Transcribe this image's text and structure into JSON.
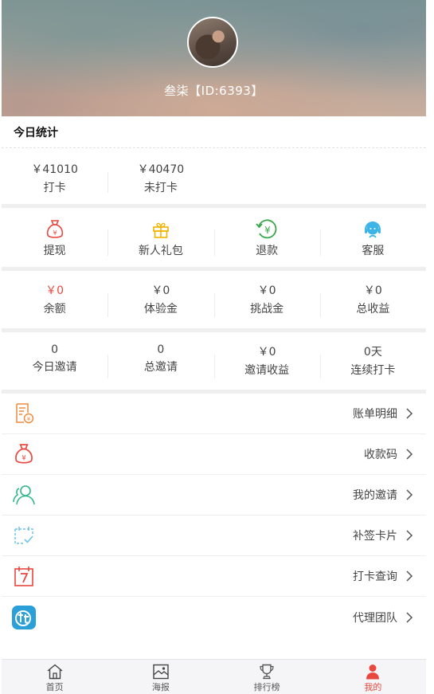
{
  "profile": {
    "name_id": "叁柒【ID:6393】"
  },
  "today": {
    "title": "今日统计",
    "stats": [
      {
        "value": "￥41010",
        "label": "打卡"
      },
      {
        "value": "￥40470",
        "label": "未打卡"
      }
    ]
  },
  "actions": [
    {
      "label": "提现",
      "icon": "money-bag-icon"
    },
    {
      "label": "新人礼包",
      "icon": "gift-icon"
    },
    {
      "label": "退款",
      "icon": "refund-icon"
    },
    {
      "label": "客服",
      "icon": "customer-service-icon"
    }
  ],
  "wallet": [
    {
      "value": "￥0",
      "label": "余额"
    },
    {
      "value": "￥0",
      "label": "体验金"
    },
    {
      "value": "￥0",
      "label": "挑战金"
    },
    {
      "value": "￥0",
      "label": "总收益"
    }
  ],
  "invites": [
    {
      "value": "0",
      "label": "今日邀请"
    },
    {
      "value": "0",
      "label": "总邀请"
    },
    {
      "value": "￥0",
      "label": "邀请收益"
    },
    {
      "value": "0天",
      "label": "连续打卡"
    }
  ],
  "menu": [
    {
      "label": "账单明细",
      "icon": "bill-icon"
    },
    {
      "label": "收款码",
      "icon": "money-bag-icon"
    },
    {
      "label": "我的邀请",
      "icon": "users-icon"
    },
    {
      "label": "补签卡片",
      "icon": "calendar-check-icon"
    },
    {
      "label": "打卡查询",
      "icon": "calendar-7-icon"
    },
    {
      "label": "代理团队",
      "icon": "team-logo-icon"
    }
  ],
  "tabbar": [
    {
      "label": "首页",
      "icon": "home-icon"
    },
    {
      "label": "海报",
      "icon": "poster-icon"
    },
    {
      "label": "排行榜",
      "icon": "trophy-icon"
    },
    {
      "label": "我的",
      "icon": "user-icon",
      "active": true
    }
  ],
  "colors": {
    "accent": "#e8483f",
    "gift": "#f0b400",
    "refund": "#3aa84a",
    "service": "#3db4e6",
    "users": "#2fb78a",
    "team": "#2a9fd8"
  }
}
